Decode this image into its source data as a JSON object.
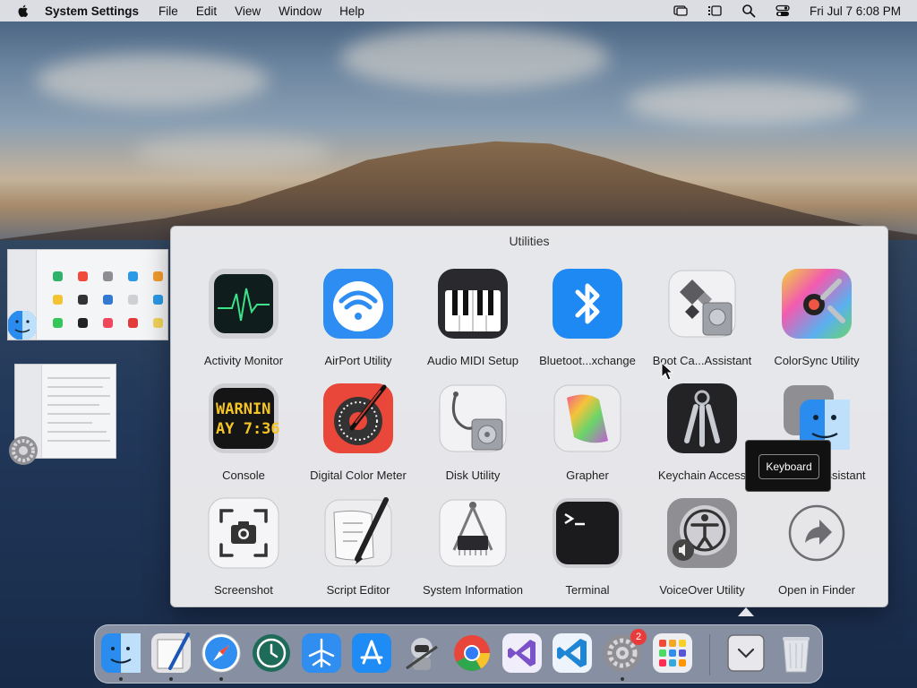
{
  "menubar": {
    "app_name": "System Settings",
    "menus": [
      "File",
      "Edit",
      "View",
      "Window",
      "Help"
    ],
    "clock": "Fri Jul 7  6:08 PM"
  },
  "folder": {
    "title": "Utilities",
    "items": [
      {
        "label": "Activity Monitor",
        "icon": "activity-monitor-icon"
      },
      {
        "label": "AirPort Utility",
        "icon": "airport-utility-icon"
      },
      {
        "label": "Audio MIDI Setup",
        "icon": "audio-midi-icon"
      },
      {
        "label": "Bluetoot...xchange",
        "icon": "bluetooth-icon"
      },
      {
        "label": "Boot Ca...Assistant",
        "icon": "boot-camp-icon"
      },
      {
        "label": "ColorSync Utility",
        "icon": "colorsync-icon"
      },
      {
        "label": "Console",
        "icon": "console-icon"
      },
      {
        "label": "Digital Color Meter",
        "icon": "color-meter-icon"
      },
      {
        "label": "Disk Utility",
        "icon": "disk-utility-icon"
      },
      {
        "label": "Grapher",
        "icon": "grapher-icon"
      },
      {
        "label": "Keychain Access",
        "icon": "keychain-icon"
      },
      {
        "label": "Migration Assistant",
        "icon": "migration-assistant-icon"
      },
      {
        "label": "Screenshot",
        "icon": "screenshot-icon"
      },
      {
        "label": "Script Editor",
        "icon": "script-editor-icon"
      },
      {
        "label": "System Information",
        "icon": "system-information-icon"
      },
      {
        "label": "Terminal",
        "icon": "terminal-icon"
      },
      {
        "label": "VoiceOver Utility",
        "icon": "voiceover-icon"
      },
      {
        "label": "Open in Finder",
        "icon": "open-in-finder-icon"
      }
    ],
    "console_icon_text": [
      "WARNIN",
      "AY 7:36"
    ]
  },
  "tooltip": {
    "text": "Keyboard"
  },
  "dock": {
    "items": [
      "Finder",
      "Script Editor",
      "Safari",
      "Time Machine",
      "TestFlight",
      "App Store",
      "Automator",
      "Chrome",
      "Visual Studio",
      "VS Code",
      "System Settings",
      "Launchpad",
      "Utilities",
      "Trash"
    ],
    "settings_badge": "2"
  },
  "colors": {
    "accent": "#2f7cf6",
    "badge": "#ea3b3b"
  }
}
